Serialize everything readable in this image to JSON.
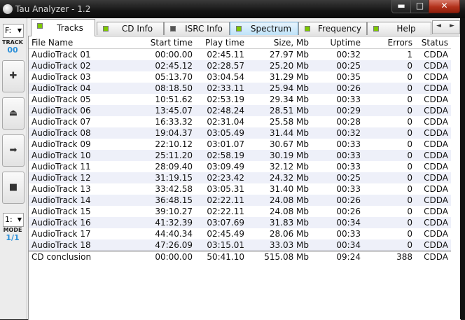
{
  "window": {
    "title": "Tau Analyzer - 1.2",
    "min_glyph": "▬",
    "max_glyph": "□",
    "close_glyph": "✕"
  },
  "sidebar": {
    "drive": "F:",
    "track_label": "TRACK",
    "track_value": "00",
    "speed": "1:",
    "mode_label": "MODE",
    "mode_value": "1/1",
    "buttons": [
      {
        "icon": "plus-icon",
        "glyph": "✚"
      },
      {
        "icon": "eject-icon",
        "glyph": "⏏"
      },
      {
        "icon": "play-icon",
        "glyph": "➡"
      },
      {
        "icon": "stop-icon",
        "glyph": "■"
      }
    ]
  },
  "tabs": [
    {
      "label": "Tracks",
      "active": true,
      "indicator": "#7ec900"
    },
    {
      "label": "CD Info",
      "active": false,
      "indicator": "#7ec900"
    },
    {
      "label": "ISRC Info",
      "active": false,
      "indicator": "#555555"
    },
    {
      "label": "Spectrum",
      "active": false,
      "indicator": "#7ec900",
      "highlight": "#bfe3f8"
    },
    {
      "label": "Frequency",
      "active": false,
      "indicator": "#7ec900"
    },
    {
      "label": "Help",
      "active": false,
      "indicator": "#7ec900"
    }
  ],
  "tab_scroll": {
    "left": "◄",
    "right": "►"
  },
  "table": {
    "columns": [
      "File Name",
      "Start time",
      "Play time",
      "Size, Mb",
      "Uptime",
      "Errors",
      "Status"
    ],
    "rows": [
      [
        "AudioTrack 01",
        "00:00.00",
        "02:45.11",
        "27.97 Mb",
        "00:32",
        "1",
        "CDDA"
      ],
      [
        "AudioTrack 02",
        "02:45.12",
        "02:28.57",
        "25.20 Mb",
        "00:25",
        "0",
        "CDDA"
      ],
      [
        "AudioTrack 03",
        "05:13.70",
        "03:04.54",
        "31.29 Mb",
        "00:35",
        "0",
        "CDDA"
      ],
      [
        "AudioTrack 04",
        "08:18.50",
        "02:33.11",
        "25.94 Mb",
        "00:26",
        "0",
        "CDDA"
      ],
      [
        "AudioTrack 05",
        "10:51.62",
        "02:53.19",
        "29.34 Mb",
        "00:33",
        "0",
        "CDDA"
      ],
      [
        "AudioTrack 06",
        "13:45.07",
        "02:48.24",
        "28.51 Mb",
        "00:29",
        "0",
        "CDDA"
      ],
      [
        "AudioTrack 07",
        "16:33.32",
        "02:31.04",
        "25.58 Mb",
        "00:28",
        "0",
        "CDDA"
      ],
      [
        "AudioTrack 08",
        "19:04.37",
        "03:05.49",
        "31.44 Mb",
        "00:32",
        "0",
        "CDDA"
      ],
      [
        "AudioTrack 09",
        "22:10.12",
        "03:01.07",
        "30.67 Mb",
        "00:33",
        "0",
        "CDDA"
      ],
      [
        "AudioTrack 10",
        "25:11.20",
        "02:58.19",
        "30.19 Mb",
        "00:33",
        "0",
        "CDDA"
      ],
      [
        "AudioTrack 11",
        "28:09.40",
        "03:09.49",
        "32.12 Mb",
        "00:33",
        "0",
        "CDDA"
      ],
      [
        "AudioTrack 12",
        "31:19.15",
        "02:23.42",
        "24.32 Mb",
        "00:25",
        "0",
        "CDDA"
      ],
      [
        "AudioTrack 13",
        "33:42.58",
        "03:05.31",
        "31.40 Mb",
        "00:33",
        "0",
        "CDDA"
      ],
      [
        "AudioTrack 14",
        "36:48.15",
        "02:22.11",
        "24.08 Mb",
        "00:26",
        "0",
        "CDDA"
      ],
      [
        "AudioTrack 15",
        "39:10.27",
        "02:22.11",
        "24.08 Mb",
        "00:26",
        "0",
        "CDDA"
      ],
      [
        "AudioTrack 16",
        "41:32.39",
        "03:07.69",
        "31.83 Mb",
        "00:34",
        "0",
        "CDDA"
      ],
      [
        "AudioTrack 17",
        "44:40.34",
        "02:45.49",
        "28.06 Mb",
        "00:33",
        "0",
        "CDDA"
      ],
      [
        "AudioTrack 18",
        "47:26.09",
        "03:15.01",
        "33.03 Mb",
        "00:34",
        "0",
        "CDDA"
      ]
    ],
    "conclusion": [
      "CD conclusion",
      "00:00.00",
      "50:41.10",
      "515.08 Mb",
      "09:24",
      "388",
      "CDDA"
    ]
  }
}
